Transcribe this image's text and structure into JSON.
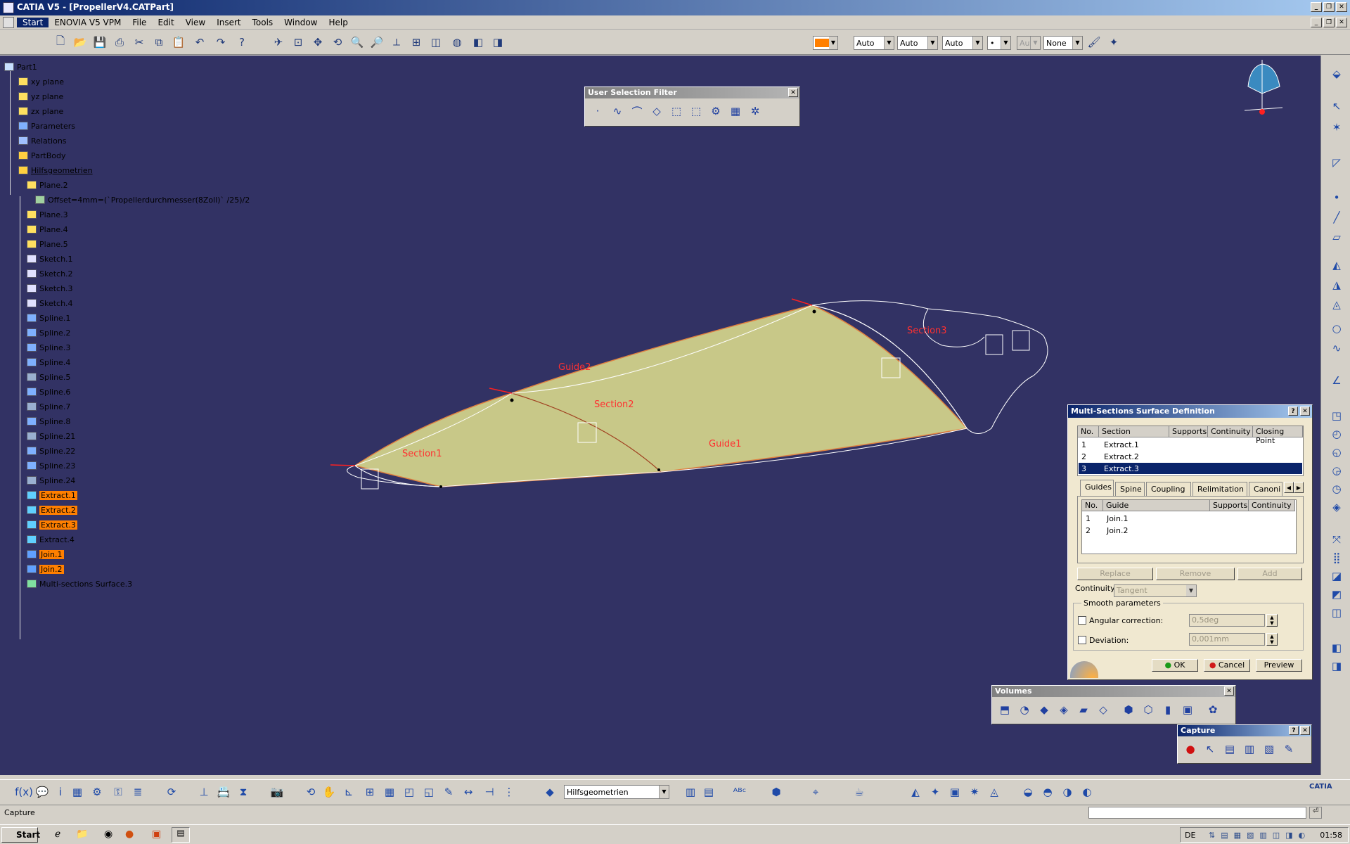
{
  "window": {
    "title": "CATIA V5 - [PropellerV4.CATPart]"
  },
  "menu": {
    "items": [
      "Start",
      "ENOVIA V5 VPM",
      "File",
      "Edit",
      "View",
      "Insert",
      "Tools",
      "Window",
      "Help"
    ]
  },
  "graphic_properties": {
    "color_swatch": "#ff7f00",
    "linetype": "Auto",
    "thickness": "Auto",
    "point": "Auto",
    "dot": "•",
    "layer_disabled": "Aut",
    "layer": "None"
  },
  "tree": {
    "items": [
      {
        "label": "Part1",
        "level": 0,
        "icon": "part-icon",
        "hl": false
      },
      {
        "label": "xy plane",
        "level": 1,
        "icon": "plane-icon",
        "hl": false
      },
      {
        "label": "yz plane",
        "level": 1,
        "icon": "plane-icon",
        "hl": false
      },
      {
        "label": "zx plane",
        "level": 1,
        "icon": "plane-icon",
        "hl": false
      },
      {
        "label": "Parameters",
        "level": 1,
        "icon": "parameters-icon",
        "hl": false
      },
      {
        "label": "Relations",
        "level": 1,
        "icon": "relations-icon",
        "hl": false
      },
      {
        "label": "PartBody",
        "level": 1,
        "icon": "body-icon",
        "hl": false
      },
      {
        "label": "Hilfsgeometrien",
        "level": 1,
        "icon": "geometrical-set-icon",
        "hl": false,
        "underline": true
      },
      {
        "label": "Plane.2",
        "level": 2,
        "icon": "plane-icon",
        "hl": false
      },
      {
        "label": "Offset=4mm=(`Propellerdurchmesser(8Zoll)` /25)/2",
        "level": 3,
        "icon": "formula-icon",
        "hl": false
      },
      {
        "label": "Plane.3",
        "level": 2,
        "icon": "plane-icon",
        "hl": false
      },
      {
        "label": "Plane.4",
        "level": 2,
        "icon": "plane-icon",
        "hl": false
      },
      {
        "label": "Plane.5",
        "level": 2,
        "icon": "plane-icon",
        "hl": false
      },
      {
        "label": "Sketch.1",
        "level": 2,
        "icon": "sketch-icon",
        "hl": false
      },
      {
        "label": "Sketch.2",
        "level": 2,
        "icon": "sketch-icon",
        "hl": false
      },
      {
        "label": "Sketch.3",
        "level": 2,
        "icon": "sketch-icon",
        "hl": false
      },
      {
        "label": "Sketch.4",
        "level": 2,
        "icon": "sketch-icon",
        "hl": false
      },
      {
        "label": "Spline.1",
        "level": 2,
        "icon": "spline-icon",
        "hl": false
      },
      {
        "label": "Spline.2",
        "level": 2,
        "icon": "spline-icon",
        "hl": false
      },
      {
        "label": "Spline.3",
        "level": 2,
        "icon": "spline-icon",
        "hl": false
      },
      {
        "label": "Spline.4",
        "level": 2,
        "icon": "spline-icon",
        "hl": false
      },
      {
        "label": "Spline.5",
        "level": 2,
        "icon": "spline-hidden-icon",
        "hl": false
      },
      {
        "label": "Spline.6",
        "level": 2,
        "icon": "spline-icon",
        "hl": false
      },
      {
        "label": "Spline.7",
        "level": 2,
        "icon": "spline-hidden-icon",
        "hl": false
      },
      {
        "label": "Spline.8",
        "level": 2,
        "icon": "spline-icon",
        "hl": false
      },
      {
        "label": "Spline.21",
        "level": 2,
        "icon": "spline-hidden-icon",
        "hl": false
      },
      {
        "label": "Spline.22",
        "level": 2,
        "icon": "spline-icon",
        "hl": false
      },
      {
        "label": "Spline.23",
        "level": 2,
        "icon": "spline-icon",
        "hl": false
      },
      {
        "label": "Spline.24",
        "level": 2,
        "icon": "spline-hidden-icon",
        "hl": false
      },
      {
        "label": "Extract.1",
        "level": 2,
        "icon": "extract-icon",
        "hl": true
      },
      {
        "label": "Extract.2",
        "level": 2,
        "icon": "extract-icon",
        "hl": true
      },
      {
        "label": "Extract.3",
        "level": 2,
        "icon": "extract-icon",
        "hl": true
      },
      {
        "label": "Extract.4",
        "level": 2,
        "icon": "extract-icon",
        "hl": false
      },
      {
        "label": "Join.1",
        "level": 2,
        "icon": "join-icon",
        "hl": true
      },
      {
        "label": "Join.2",
        "level": 2,
        "icon": "join-icon",
        "hl": true
      },
      {
        "label": "Multi-sections Surface.3",
        "level": 2,
        "icon": "multisection-icon",
        "hl": false
      }
    ]
  },
  "selection_filter": {
    "title": "User Selection Filter"
  },
  "model_labels": {
    "section1": "Section1",
    "section2": "Section2",
    "section3": "Section3",
    "guide1": "Guide1",
    "guide2": "Guide2"
  },
  "dialog": {
    "title": "Multi-Sections Surface Definition",
    "section_headers": [
      "No.",
      "Section",
      "Supports",
      "Continuity",
      "Closing Point"
    ],
    "sections": [
      {
        "no": "1",
        "name": "Extract.1"
      },
      {
        "no": "2",
        "name": "Extract.2"
      },
      {
        "no": "3",
        "name": "Extract.3"
      }
    ],
    "tabs": [
      "Guides",
      "Spine",
      "Coupling",
      "Relimitation",
      "Canoni"
    ],
    "guide_headers": [
      "No.",
      "Guide",
      "Supports",
      "Continuity"
    ],
    "guides": [
      {
        "no": "1",
        "name": "Join.1"
      },
      {
        "no": "2",
        "name": "Join.2"
      }
    ],
    "replace": "Replace",
    "remove": "Remove",
    "add": "Add",
    "continuity_label": "Continuity:",
    "continuity_value": "Tangent",
    "smooth_label": "Smooth parameters",
    "angular_label": "Angular correction:",
    "angular_value": "0,5deg",
    "deviation_label": "Deviation:",
    "deviation_value": "0,001mm",
    "ok": "OK",
    "cancel": "Cancel",
    "preview": "Preview"
  },
  "volumes": {
    "title": "Volumes"
  },
  "capture": {
    "title": "Capture"
  },
  "bottom_toolbar": {
    "current_set": "Hilfsgeometrien"
  },
  "status": {
    "text": "Capture"
  },
  "taskbar": {
    "start": "Start",
    "lang": "DE",
    "time": "01:58"
  },
  "brand": {
    "catia": "CATIA"
  }
}
